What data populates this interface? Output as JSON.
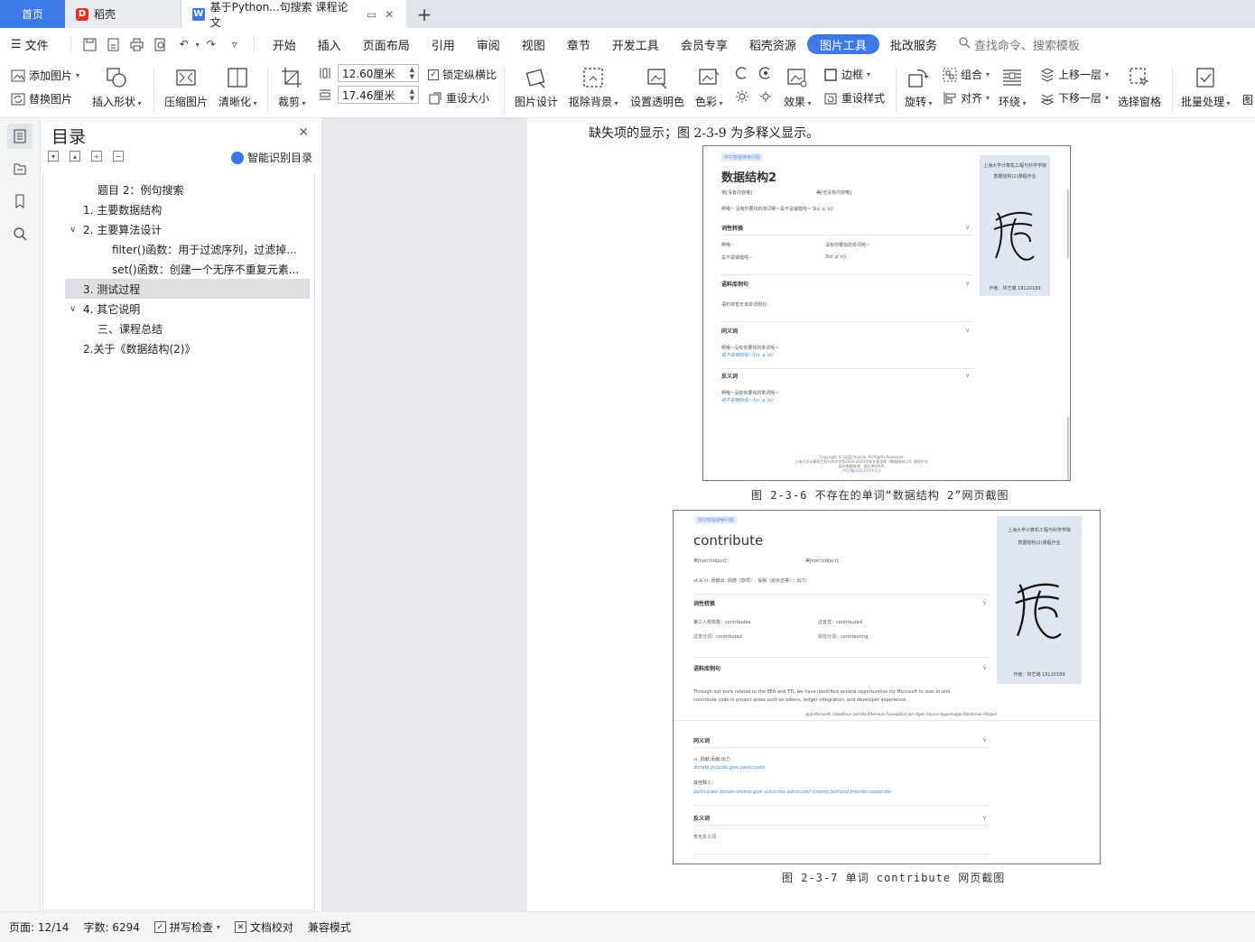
{
  "titlebar": {
    "tabs": [
      {
        "label": "首页"
      },
      {
        "label": "稻壳"
      },
      {
        "label": "基于Python...句搜索 课程论文"
      }
    ]
  },
  "menubar": {
    "file": "文件",
    "items": [
      "开始",
      "插入",
      "页面布局",
      "引用",
      "审阅",
      "视图",
      "章节",
      "开发工具",
      "会员专享",
      "稻壳资源",
      "图片工具",
      "批改服务"
    ],
    "active": "图片工具",
    "search_placeholder": "查找命令、搜索模板"
  },
  "ribbon": {
    "add_image": "添加图片",
    "replace_image": "替换图片",
    "insert_shape": "插入形状",
    "compress": "压缩图片",
    "sharpen": "清晰化",
    "crop": "裁剪",
    "width": "12.60厘米",
    "height": "17.46厘米",
    "lock_ratio": "锁定纵横比",
    "reset_size": "重设大小",
    "image_design": "图片设计",
    "remove_bg": "抠除背景",
    "set_transparent": "设置透明色",
    "color": "色彩",
    "effect": "效果",
    "border": "边框",
    "reset_style": "重设样式",
    "rotate": "旋转",
    "group": "组合",
    "align": "对齐",
    "wrap": "环绕",
    "bring_forward": "上移一层",
    "send_backward": "下移一层",
    "selection_pane": "选择窗格",
    "batch": "批量处理",
    "more": "图"
  },
  "toc": {
    "title": "目录",
    "smart": "智能识别目录",
    "items": [
      {
        "label": "题目 2：例句搜索"
      },
      {
        "label": "1. 主要数据结构"
      },
      {
        "label": "2. 主要算法设计"
      },
      {
        "label": "filter()函数：用于过滤序列，过滤掉..."
      },
      {
        "label": "set()函数：创建一个无序不重复元素..."
      },
      {
        "label": "3. 测试过程"
      },
      {
        "label": "4. 其它说明"
      },
      {
        "label": "三、课程总结"
      },
      {
        "label": "2.关于《数据结构(2)》"
      }
    ]
  },
  "document": {
    "top_text": "缺失项的显示；图 2-3-9 为多释义显示。",
    "caption1": "图 2-3-6 不存在的单词“数据结构 2”网页截图",
    "caption2": "图 2-3-7 单词 contribute 网页截图",
    "shot1": {
      "tag": "例句智能搜索问题",
      "title": "数据结构2",
      "uk": "英[没有内容哦]",
      "us": "美[也没有内容哦]",
      "def": "啊哦~ 没有你要找的单词呢~是不是输错啦~ 3(o`д´o)/",
      "sec1": "词性转换",
      "r1a": "啊哦~",
      "r1b": "没有你要找的单词呢~",
      "r2a": "是不是输错啦~",
      "r2b": "3(o`д´o)/",
      "sec2": "语料库例句",
      "corpus": "语料库暂无该单词例句",
      "sec3": "同义词",
      "syn1": "啊哦~没有你要找的单词呢~",
      "syn2": "是不是输错啦~3(o`д´o)/",
      "sec4": "反义词",
      "ant1": "啊哦~没有你要找的单词呢~",
      "ant2": "是不是输错啦~3(o`д´o)/",
      "card1": "上海大学计算机工程与科学学院",
      "card2": "数据结构(2)课程作业",
      "author": "作者：林艺璐 18120189",
      "foot1": "Copyright © 2020 Yuanlin. All Rights Reserved",
      "foot2": "上海大学计算机工程与科学学院2019-2020学年冬季学期《数据结构(2)》课程作业",
      "foot3": "部分数据来源：扇贝单词API",
      "foot4": "沪ICP备2021XXXX号-1"
    },
    "shot2": {
      "tag": "例句智能搜索问题",
      "title": "contribute",
      "uk": "英[kən'trɪbjuːt]",
      "us": "美[kən'trɪbjuːt]",
      "def": "vt.& vi. 贡献出; 捐赠（款项）; 投稿（给杂志等）; 出力;",
      "sec1": "词性转换",
      "r1a": "第三人称单数：contributes",
      "r1b": "过去式：contributed",
      "r2a": "过去分词：contributed",
      "r2b": "现在分词：contributing",
      "sec2": "语料库例句",
      "ex1": "Through our work related to the EEA and TTI, we have identified several opportunities for Microsoft to lean in and",
      "ex2": "contribute code in project areas such as tokens, ledger integration, and developer experience.",
      "ex_src": "出自 Microsoft, Salesforce and the Ethereum Foundation Join Open Source Hyperledger Blockchain Project",
      "sec3": "同义词",
      "syn_def": "vi. 捐献;贡献;出力",
      "syn_words": "donate provide give participate",
      "other": "其他释义",
      "other_words": "participate donate endow give subscribe administer extend befriend provide cooperate",
      "sec4": "反义词",
      "ant": "暂无反义词",
      "card1": "上海大学计算机工程与科学学院",
      "card2": "数据结构(2)课程作业",
      "author": "作者：林艺璐 18120189"
    }
  },
  "statusbar": {
    "page": "页面: 12/14",
    "words": "字数: 6294",
    "spell": "拼写检查",
    "proof": "文档校对",
    "compat": "兼容模式"
  }
}
